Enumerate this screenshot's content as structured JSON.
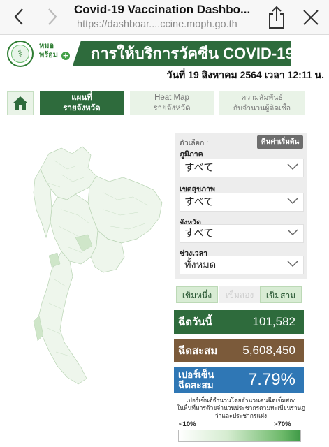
{
  "browser": {
    "page_title": "Covid-19 Vaccination Dashbo...",
    "url": "https://dashboar....ccine.moph.go.th",
    "icons": [
      "back-arrow-icon",
      "forward-arrow-icon",
      "share-icon",
      "close-icon"
    ]
  },
  "header": {
    "logo_text": "⚕",
    "brand_line1": "หมอ",
    "brand_line2": "พร้อม",
    "brand_plus": "+",
    "title": "การให้บริการวัคซีน COVID-19",
    "date_line": "วันที่ 19 สิงหาคม 2564 เวลา 12:11 น."
  },
  "tabs": [
    {
      "label_line1": "แผนที่",
      "label_line2": "รายจังหวัด",
      "active": true
    },
    {
      "label_line1": "Heat Map",
      "label_line2": "รายจังหวัด",
      "active": false
    },
    {
      "label_line1": "ความสัมพันธ์",
      "label_line2": "กับจำนวนผู้ติดเชื้อ",
      "active": false
    }
  ],
  "filters": {
    "options_label": "ตัวเลือก :",
    "reset_label": "คืนค่าเริ่มต้น",
    "region": {
      "label": "ภูมิภาค",
      "value": "すべて"
    },
    "health_zone": {
      "label": "เขตสุขภาพ",
      "value": "すべて"
    },
    "province": {
      "label": "จังหวัด",
      "value": "すべて"
    },
    "period": {
      "label": "ช่วงเวลา",
      "value": "ทั้งหมด"
    }
  },
  "doses": [
    {
      "label": "เข็มหนึ่ง",
      "active": true
    },
    {
      "label": "เข็มสอง",
      "active": false
    },
    {
      "label": "เข็มสาม",
      "active": true
    }
  ],
  "stats": {
    "today": {
      "label": "ฉีดวันนี้",
      "value": "101,582"
    },
    "cumulative": {
      "label": "ฉีดสะสม",
      "value": "5,608,450"
    },
    "percent": {
      "label_line1": "เปอร์เซ็น",
      "label_line2": "ฉีดสะสม",
      "value": "7.79%"
    }
  },
  "legend": {
    "note_line1": "เปอร์เซ็นต์จำนวนโดยจำนวนคนฉีดเข็มสอง",
    "note_line2": "ในพื้นที่หารด้วยจำนวนประชากรตามทะเบียนราษฎ",
    "note_line3": "ว่าและประชากรแฝง",
    "min": "<10%",
    "max": ">70%"
  },
  "colors": {
    "primary_green": "#2e6b3c",
    "brown": "#7b5a3a",
    "blue": "#2f77b5",
    "map_fill": "#eef6ec",
    "map_stroke": "#b9d4b4"
  }
}
